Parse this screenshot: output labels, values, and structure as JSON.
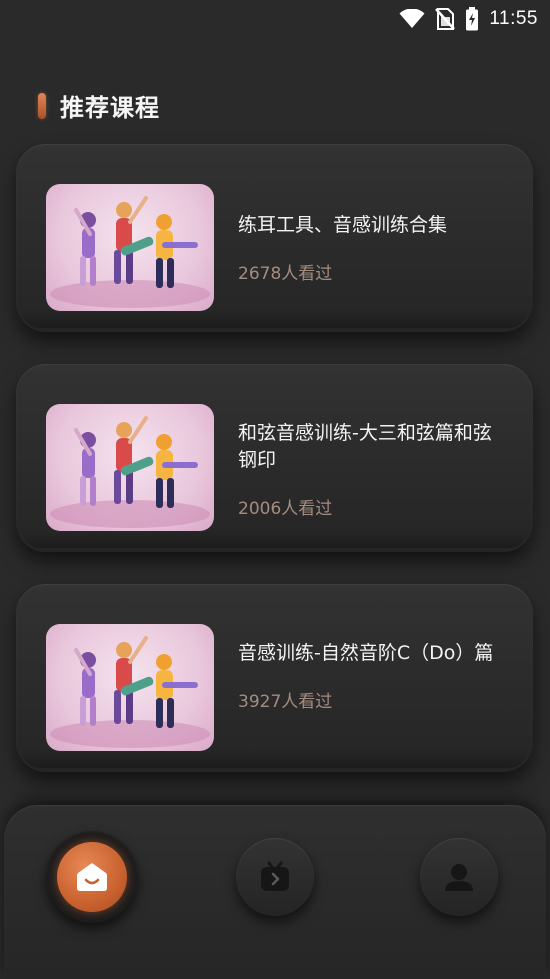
{
  "status_bar": {
    "time": "11:55",
    "icons": [
      "wifi-icon",
      "no-sim-icon",
      "battery-charging-icon"
    ]
  },
  "section": {
    "title": "推荐课程"
  },
  "courses": [
    {
      "title": "练耳工具、音感训练合集",
      "views": "2678人看过",
      "thumbnail": "band-illustration"
    },
    {
      "title": "和弦音感训练-大三和弦篇和弦钢印",
      "views": "2006人看过",
      "thumbnail": "band-illustration"
    },
    {
      "title": "音感训练-自然音阶C（Do）篇",
      "views": "3927人看过",
      "thumbnail": "band-illustration"
    }
  ],
  "bottom_nav": {
    "items": [
      {
        "icon": "home-smile-icon",
        "active": true
      },
      {
        "icon": "video-tv-icon",
        "active": false
      },
      {
        "icon": "profile-icon",
        "active": false
      }
    ]
  },
  "colors": {
    "background": "#2a2a2a",
    "accent": "#d2693a",
    "views_text": "#a58c80"
  }
}
